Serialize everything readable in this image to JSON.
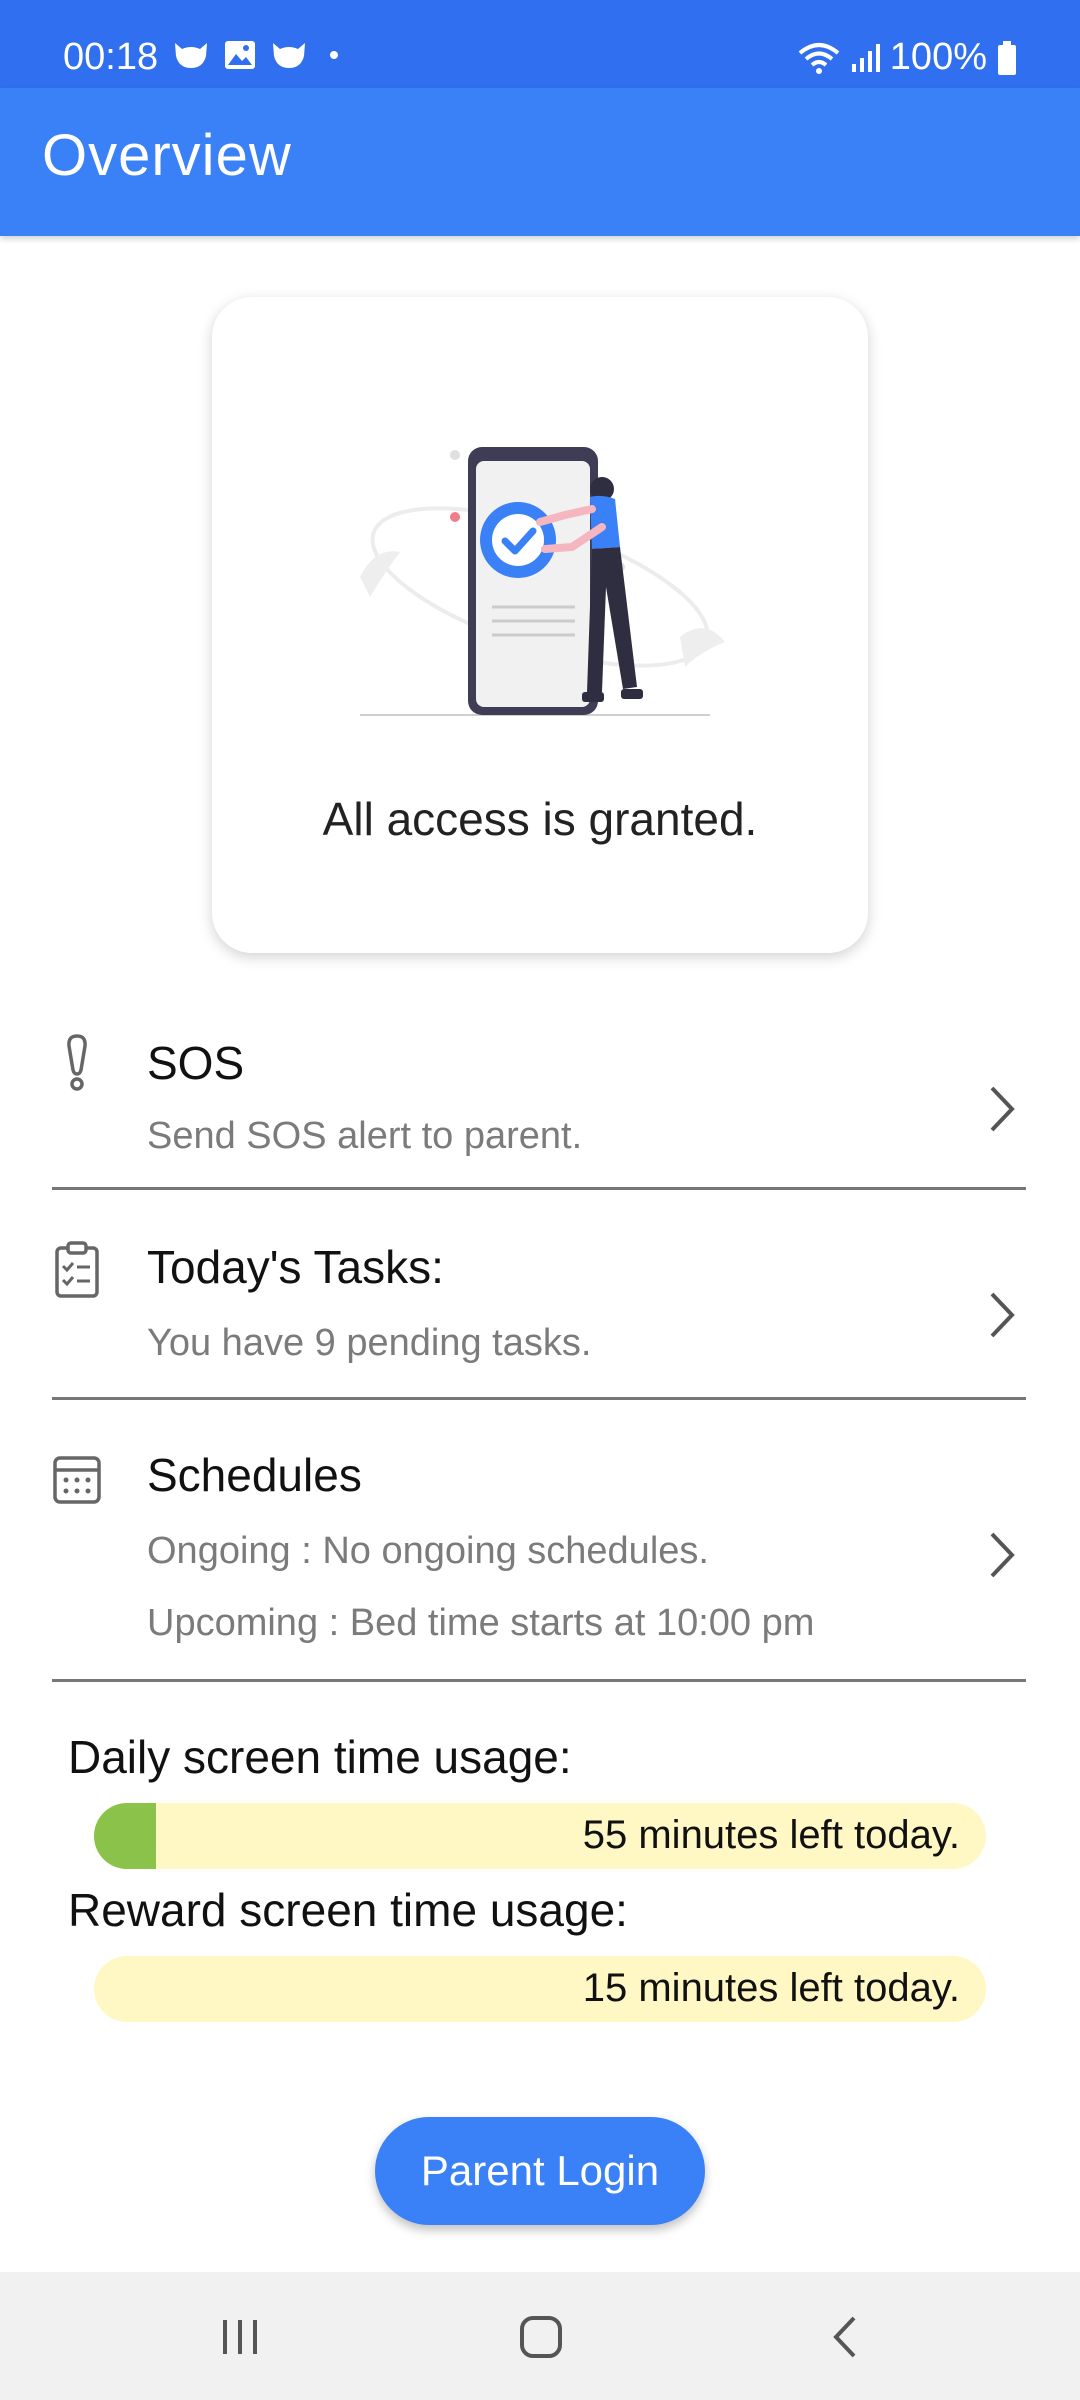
{
  "status_bar": {
    "time": "00:18",
    "battery": "100%"
  },
  "app_bar": {
    "title": "Overview"
  },
  "card": {
    "message": "All access is granted."
  },
  "rows": [
    {
      "title": "SOS",
      "subtitle": "Send SOS alert to parent."
    },
    {
      "title": "Today's Tasks:",
      "subtitle": "You have 9 pending tasks."
    },
    {
      "title": "Schedules",
      "ongoing": "Ongoing : No ongoing schedules.",
      "upcoming": "Upcoming : Bed time starts at 10:00 pm"
    }
  ],
  "usage": {
    "daily_label": "Daily screen time usage:",
    "daily_text": "55 minutes left today.",
    "daily_used_fraction": 0.07,
    "reward_label": "Reward screen time usage:",
    "reward_text": "15 minutes left today.",
    "reward_used_fraction": 0.0
  },
  "button": {
    "label": "Parent Login"
  },
  "colors": {
    "primary": "#3a80f7",
    "status": "#2f6ff0",
    "usage_fill": "#8bc34a",
    "usage_track": "#fff8c4"
  },
  "icons": [
    "exclamation-icon",
    "clipboard-icon",
    "calendar-icon",
    "chevron-right-icon",
    "recents-icon",
    "home-icon",
    "back-icon"
  ]
}
